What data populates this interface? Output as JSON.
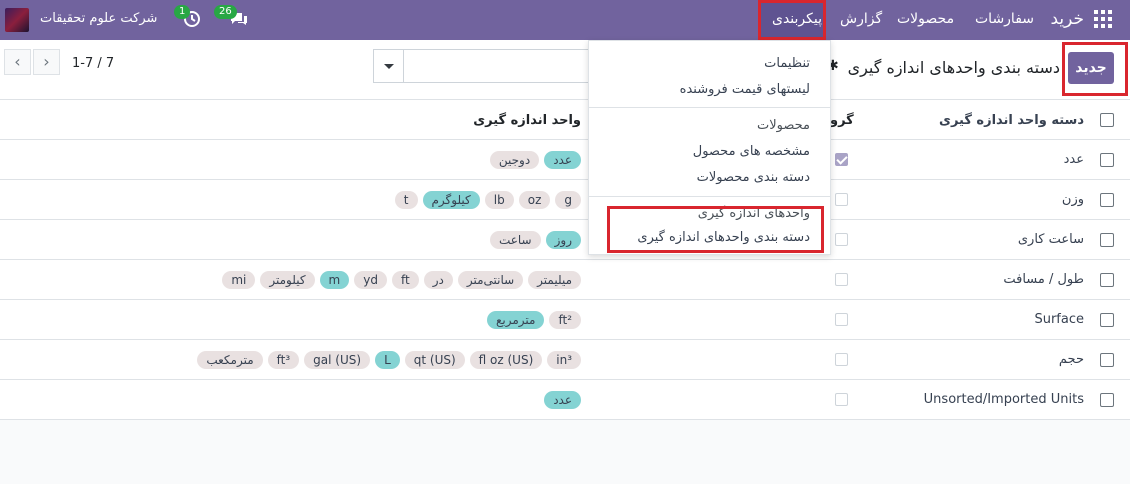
{
  "navbar": {
    "brand": "خرید",
    "menu": [
      {
        "label": "سفارشات"
      },
      {
        "label": "محصولات"
      },
      {
        "label": "گزارش"
      },
      {
        "label": "پیکربندی"
      }
    ],
    "company": "شرکت علوم تحقیقات",
    "activity_count": "1",
    "messages_count": "26"
  },
  "control": {
    "new_button": "جدید",
    "title": "دسته بندی واحدهای اندازه گیری",
    "pager_value": "1-7 / 7"
  },
  "table": {
    "col_name": "دسته واحد اندازه گیری",
    "col_group": "گرو",
    "col_uom": "واحد اندازه گیری",
    "rows": [
      {
        "name": "عدد",
        "group": true,
        "tags": [
          {
            "label": "عدد",
            "ref": true
          },
          {
            "label": "دوجین",
            "ref": false
          }
        ]
      },
      {
        "name": "وزن",
        "group": false,
        "tags": [
          {
            "label": "g",
            "ref": false
          },
          {
            "label": "oz",
            "ref": false
          },
          {
            "label": "lb",
            "ref": false
          },
          {
            "label": "کیلوگرم",
            "ref": true
          },
          {
            "label": "t",
            "ref": false
          }
        ]
      },
      {
        "name": "ساعت کاری",
        "group": false,
        "tags": [
          {
            "label": "روز",
            "ref": true
          },
          {
            "label": "ساعت",
            "ref": false
          }
        ]
      },
      {
        "name": "طول / مسافت",
        "group": false,
        "tags": [
          {
            "label": "میلیمتر",
            "ref": false
          },
          {
            "label": "سانتی‌متر",
            "ref": false
          },
          {
            "label": "در",
            "ref": false
          },
          {
            "label": "ft",
            "ref": false
          },
          {
            "label": "yd",
            "ref": false
          },
          {
            "label": "m",
            "ref": true
          },
          {
            "label": "کیلومتر",
            "ref": false
          },
          {
            "label": "mi",
            "ref": false
          }
        ]
      },
      {
        "name": "Surface",
        "group": false,
        "tags": [
          {
            "label": "ft²",
            "ref": false
          },
          {
            "label": "مترمربع",
            "ref": true
          }
        ]
      },
      {
        "name": "حجم",
        "group": false,
        "tags": [
          {
            "label": "in³",
            "ref": false
          },
          {
            "label": "fl oz (US)",
            "ref": false
          },
          {
            "label": "qt (US)",
            "ref": false
          },
          {
            "label": "L",
            "ref": true
          },
          {
            "label": "gal (US)",
            "ref": false
          },
          {
            "label": "ft³",
            "ref": false
          },
          {
            "label": "مترمکعب",
            "ref": false
          }
        ]
      },
      {
        "name": "Unsorted/Imported Units",
        "group": false,
        "tags": [
          {
            "label": "عدد",
            "ref": true
          }
        ]
      }
    ]
  },
  "dropdown": {
    "settings": "تنظیمات",
    "pricelists": "لیستهای قیمت فروشنده",
    "section_products": "محصولات",
    "attributes": "مشخصه های محصول",
    "product_categories": "دسته بندی محصولات",
    "section_uom": "واحدهای اندازه گیری",
    "uom_categories": "دسته بندی واحدهای اندازه گیری"
  },
  "colors": {
    "navbar": "#71639e",
    "highlight": "#d9262e",
    "tag_ref": "#84d3d3",
    "tag": "#e9e1e1"
  }
}
